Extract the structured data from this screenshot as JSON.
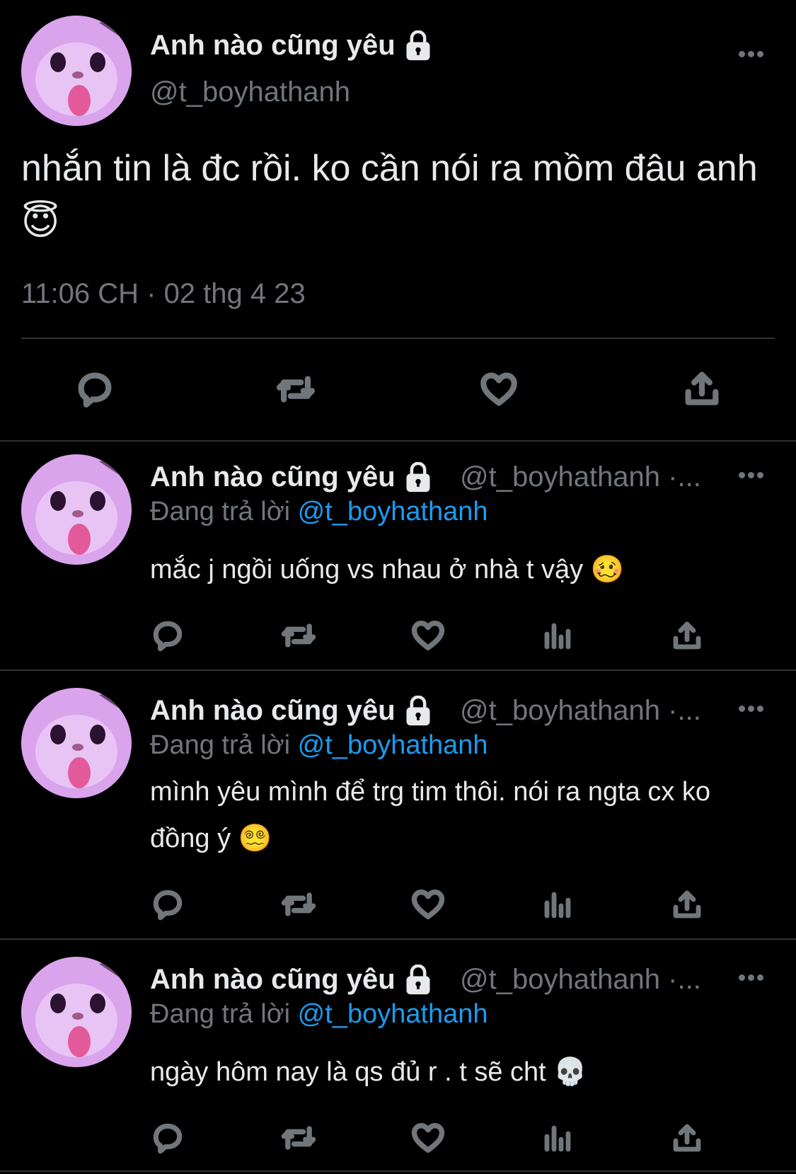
{
  "main_tweet": {
    "display_name": "Anh nào cũng yêu",
    "handle": "@t_boyhathanh",
    "text": "nhắn tin là đc rồi. ko cần nói ra mồm đâu anh 😇",
    "timestamp": "11:06 CH · 02 thg 4 23"
  },
  "replies": [
    {
      "display_name": "Anh nào cũng yêu",
      "handle": "@t_boyhathanh ·...",
      "replying_label": "Đang trả lời",
      "replying_to": "@t_boyhathanh",
      "text": "mắc j ngồi uống vs nhau ở nhà t vậy 🥴"
    },
    {
      "display_name": "Anh nào cũng yêu",
      "handle": "@t_boyhathanh ·...",
      "replying_label": "Đang trả lời",
      "replying_to": "@t_boyhathanh",
      "text": "mình yêu mình để trg tim thôi. nói ra ngta cx ko đồng ý 😵‍💫"
    },
    {
      "display_name": "Anh nào cũng yêu",
      "handle": "@t_boyhathanh ·...",
      "replying_label": "Đang trả lời",
      "replying_to": "@t_boyhathanh",
      "text": "ngày hôm nay là qs đủ r . t sẽ cht 💀"
    }
  ],
  "icons": {
    "reply": "comment-icon",
    "retweet": "retweet-icon",
    "like": "heart-icon",
    "views": "views-icon",
    "share": "share-icon",
    "more": "more-icon",
    "lock": "lock-icon"
  },
  "colors": {
    "background": "#000000",
    "text": "#e7e9ea",
    "secondary": "#71767b",
    "link": "#1d9bf0",
    "divider": "#2f3336"
  }
}
